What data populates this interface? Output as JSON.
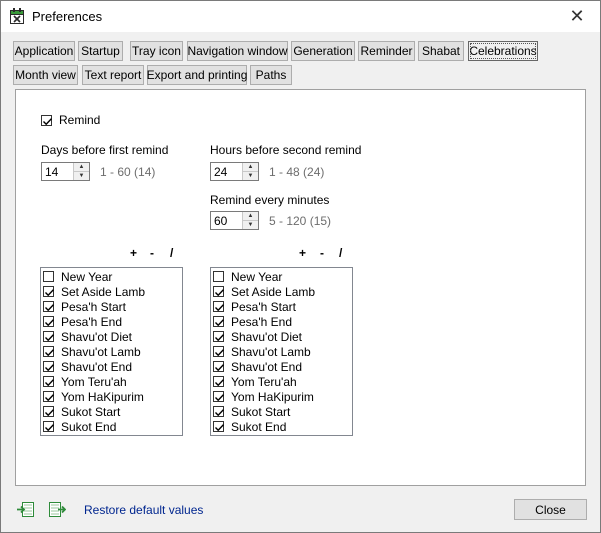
{
  "window": {
    "title": "Preferences",
    "close_glyph": "✕"
  },
  "tabs_row1": [
    {
      "label": "Application"
    },
    {
      "label": "Startup"
    },
    {
      "label": "Tray icon"
    },
    {
      "label": "Navigation window"
    },
    {
      "label": "Generation"
    },
    {
      "label": "Reminder"
    },
    {
      "label": "Shabat"
    },
    {
      "label": "Celebrations",
      "active": true
    }
  ],
  "tabs_row2": [
    {
      "label": "Month view"
    },
    {
      "label": "Text report"
    },
    {
      "label": "Export and printing"
    },
    {
      "label": "Paths"
    }
  ],
  "remind": {
    "label": "Remind",
    "checked": true
  },
  "days_first": {
    "label": "Days before first remind",
    "value": "14",
    "range": "1 - 60 (14)"
  },
  "hours_second": {
    "label": "Hours before second remind",
    "value": "24",
    "range": "1 - 48 (24)"
  },
  "remind_every": {
    "label": "Remind every minutes",
    "value": "60",
    "range": "5 - 120 (15)"
  },
  "ops": {
    "plus": "+",
    "minus": "-",
    "slash": "/"
  },
  "list_left": [
    {
      "label": "New Year",
      "checked": false
    },
    {
      "label": "Set Aside Lamb",
      "checked": true
    },
    {
      "label": "Pesa'h Start",
      "checked": true
    },
    {
      "label": "Pesa'h End",
      "checked": true
    },
    {
      "label": "Shavu'ot Diet",
      "checked": true
    },
    {
      "label": "Shavu'ot Lamb",
      "checked": true
    },
    {
      "label": "Shavu'ot End",
      "checked": true
    },
    {
      "label": "Yom Teru'ah",
      "checked": true
    },
    {
      "label": "Yom HaKipurim",
      "checked": true
    },
    {
      "label": "Sukot Start",
      "checked": true
    },
    {
      "label": "Sukot End",
      "checked": true
    }
  ],
  "list_right": [
    {
      "label": "New Year",
      "checked": false
    },
    {
      "label": "Set Aside Lamb",
      "checked": true
    },
    {
      "label": "Pesa'h Start",
      "checked": true
    },
    {
      "label": "Pesa'h End",
      "checked": true
    },
    {
      "label": "Shavu'ot Diet",
      "checked": true
    },
    {
      "label": "Shavu'ot Lamb",
      "checked": true
    },
    {
      "label": "Shavu'ot End",
      "checked": true
    },
    {
      "label": "Yom Teru'ah",
      "checked": true
    },
    {
      "label": "Yom HaKipurim",
      "checked": true
    },
    {
      "label": "Sukot Start",
      "checked": true
    },
    {
      "label": "Sukot End",
      "checked": true
    }
  ],
  "footer": {
    "import_icon": "import-icon",
    "export_icon": "export-icon",
    "restore_label": "Restore default values",
    "close_label": "Close"
  },
  "colors": {
    "link": "#00268f",
    "range_text": "#6d6d6d",
    "icon_green": "#2e8b3a"
  }
}
